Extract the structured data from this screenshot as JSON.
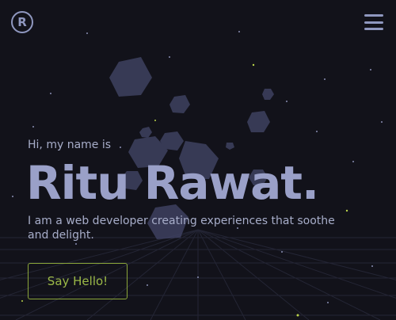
{
  "header": {
    "logo_letter": "R",
    "logo_icon": "r-circle-logo-icon",
    "menu_icon": "hamburger-menu-icon"
  },
  "hero": {
    "greeting": "Hi, my name is",
    "name": "Ritu Rawat.",
    "tagline": "I am a web developer creating experiences that soothe and delight.",
    "cta_label": "Say Hello!"
  },
  "colors": {
    "background": "#12121a",
    "text": "#a7adc9",
    "heading": "#9aa0c8",
    "accent": "#9bb847",
    "shapes": "#3e4160",
    "grid": "#2a2c40"
  }
}
